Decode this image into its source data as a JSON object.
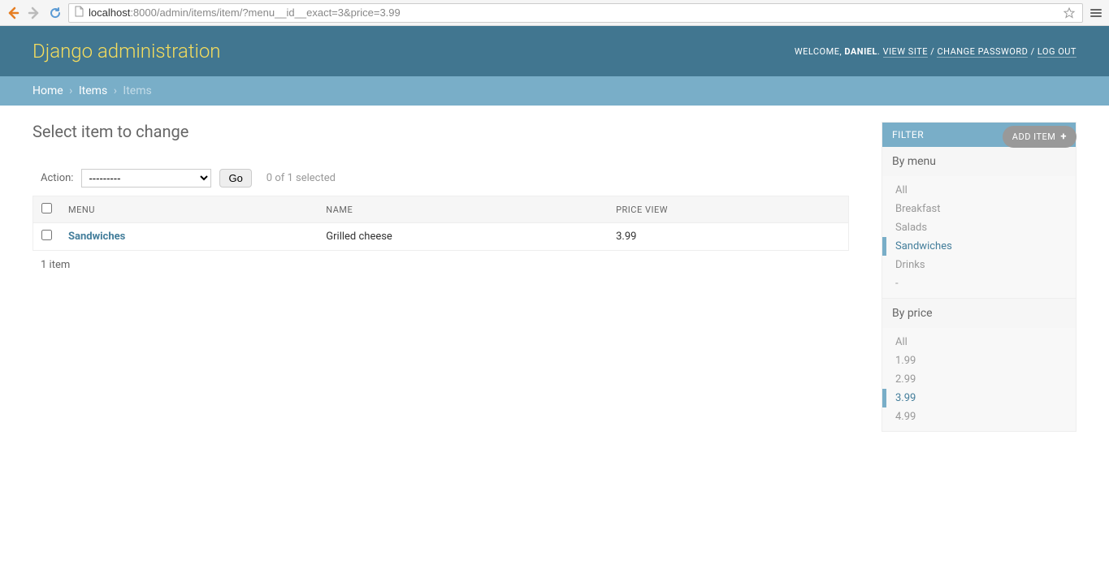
{
  "browser": {
    "url_host": "localhost",
    "url_rest": ":8000/admin/items/item/?menu__id__exact=3&price=3.99"
  },
  "header": {
    "site_title": "Django administration",
    "welcome": "WELCOME, ",
    "username": "DANIEL",
    "view_site": "VIEW SITE",
    "change_password": "CHANGE PASSWORD",
    "logout": "LOG OUT"
  },
  "breadcrumbs": {
    "home": "Home",
    "app": "Items",
    "model": "Items"
  },
  "content": {
    "title": "Select item to change",
    "add_button": "ADD ITEM"
  },
  "actions": {
    "label": "Action:",
    "placeholder": "---------",
    "go": "Go",
    "counter": "0 of 1 selected"
  },
  "table": {
    "headers": {
      "menu": "MENU",
      "name": "NAME",
      "price": "PRICE VIEW"
    },
    "rows": [
      {
        "menu": "Sandwiches",
        "name": "Grilled cheese",
        "price": "3.99"
      }
    ],
    "paginator": "1 item"
  },
  "filters": {
    "title": "FILTER",
    "by_menu": {
      "label": "By menu",
      "items": [
        {
          "label": "All",
          "selected": false
        },
        {
          "label": "Breakfast",
          "selected": false
        },
        {
          "label": "Salads",
          "selected": false
        },
        {
          "label": "Sandwiches",
          "selected": true
        },
        {
          "label": "Drinks",
          "selected": false
        },
        {
          "label": "-",
          "selected": false
        }
      ]
    },
    "by_price": {
      "label": "By price",
      "items": [
        {
          "label": "All",
          "selected": false
        },
        {
          "label": "1.99",
          "selected": false
        },
        {
          "label": "2.99",
          "selected": false
        },
        {
          "label": "3.99",
          "selected": true
        },
        {
          "label": "4.99",
          "selected": false
        }
      ]
    }
  }
}
